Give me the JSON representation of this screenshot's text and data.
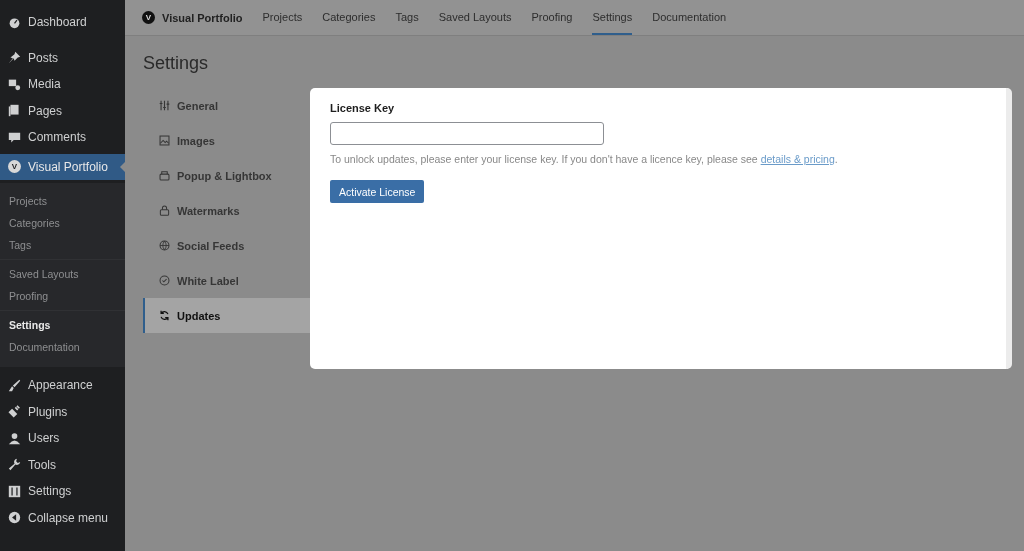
{
  "sidebar": {
    "items": [
      {
        "label": "Dashboard",
        "selected": false
      },
      {
        "label": "Posts",
        "selected": false
      },
      {
        "label": "Media",
        "selected": false
      },
      {
        "label": "Pages",
        "selected": false
      },
      {
        "label": "Comments",
        "selected": false
      },
      {
        "label": "Visual Portfolio",
        "logo_letter": "V",
        "selected": true,
        "submenu_groups": [
          [
            {
              "label": "Projects",
              "selected": false
            },
            {
              "label": "Categories",
              "selected": false
            },
            {
              "label": "Tags",
              "selected": false
            }
          ],
          [
            {
              "label": "Saved Layouts",
              "selected": false
            },
            {
              "label": "Proofing",
              "selected": false
            }
          ],
          [
            {
              "label": "Settings",
              "selected": true
            },
            {
              "label": "Documentation",
              "selected": false
            }
          ]
        ]
      },
      {
        "label": "Appearance",
        "selected": false
      },
      {
        "label": "Plugins",
        "selected": false
      },
      {
        "label": "Users",
        "selected": false
      },
      {
        "label": "Tools",
        "selected": false
      },
      {
        "label": "Settings",
        "selected": false
      },
      {
        "label": "Collapse menu",
        "selected": false
      }
    ]
  },
  "topbar": {
    "logo_letter": "V",
    "brand": "Visual Portfolio",
    "tabs": [
      {
        "label": "Projects",
        "selected": false
      },
      {
        "label": "Categories",
        "selected": false
      },
      {
        "label": "Tags",
        "selected": false
      },
      {
        "label": "Saved Layouts",
        "selected": false
      },
      {
        "label": "Proofing",
        "selected": false
      },
      {
        "label": "Settings",
        "selected": true
      },
      {
        "label": "Documentation",
        "selected": false
      }
    ]
  },
  "page_title": "Settings",
  "settings_tabs": [
    {
      "label": "General",
      "selected": false
    },
    {
      "label": "Images",
      "selected": false
    },
    {
      "label": "Popup & Lightbox",
      "selected": false
    },
    {
      "label": "Watermarks",
      "selected": false
    },
    {
      "label": "Social Feeds",
      "selected": false
    },
    {
      "label": "White Label",
      "selected": false
    },
    {
      "label": "Updates",
      "selected": true
    }
  ],
  "panel": {
    "field_label": "License Key",
    "help_text": "To unlock updates, please enter your license key. If you don't have a licence key, please see ",
    "help_link": "details & pricing",
    "help_end": ".",
    "button": "Activate License"
  }
}
